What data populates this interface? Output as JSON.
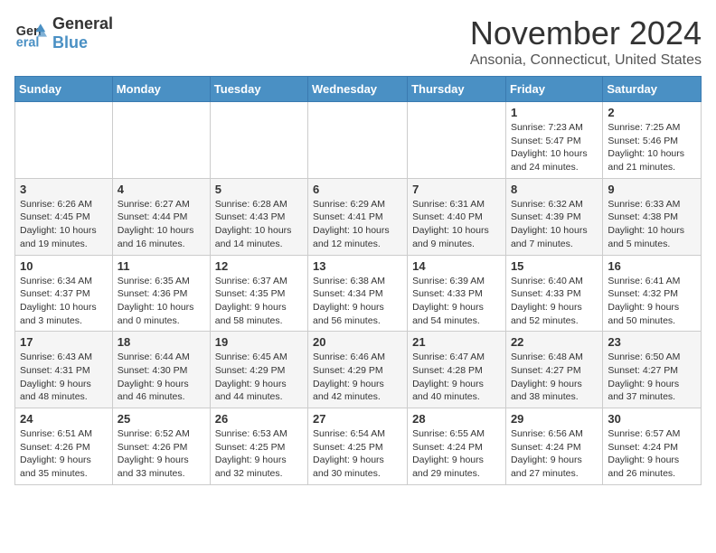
{
  "logo": {
    "line1": "General",
    "line2": "Blue"
  },
  "title": "November 2024",
  "location": "Ansonia, Connecticut, United States",
  "days_of_week": [
    "Sunday",
    "Monday",
    "Tuesday",
    "Wednesday",
    "Thursday",
    "Friday",
    "Saturday"
  ],
  "weeks": [
    [
      {
        "day": "",
        "info": ""
      },
      {
        "day": "",
        "info": ""
      },
      {
        "day": "",
        "info": ""
      },
      {
        "day": "",
        "info": ""
      },
      {
        "day": "",
        "info": ""
      },
      {
        "day": "1",
        "info": "Sunrise: 7:23 AM\nSunset: 5:47 PM\nDaylight: 10 hours and 24 minutes."
      },
      {
        "day": "2",
        "info": "Sunrise: 7:25 AM\nSunset: 5:46 PM\nDaylight: 10 hours and 21 minutes."
      }
    ],
    [
      {
        "day": "3",
        "info": "Sunrise: 6:26 AM\nSunset: 4:45 PM\nDaylight: 10 hours and 19 minutes."
      },
      {
        "day": "4",
        "info": "Sunrise: 6:27 AM\nSunset: 4:44 PM\nDaylight: 10 hours and 16 minutes."
      },
      {
        "day": "5",
        "info": "Sunrise: 6:28 AM\nSunset: 4:43 PM\nDaylight: 10 hours and 14 minutes."
      },
      {
        "day": "6",
        "info": "Sunrise: 6:29 AM\nSunset: 4:41 PM\nDaylight: 10 hours and 12 minutes."
      },
      {
        "day": "7",
        "info": "Sunrise: 6:31 AM\nSunset: 4:40 PM\nDaylight: 10 hours and 9 minutes."
      },
      {
        "day": "8",
        "info": "Sunrise: 6:32 AM\nSunset: 4:39 PM\nDaylight: 10 hours and 7 minutes."
      },
      {
        "day": "9",
        "info": "Sunrise: 6:33 AM\nSunset: 4:38 PM\nDaylight: 10 hours and 5 minutes."
      }
    ],
    [
      {
        "day": "10",
        "info": "Sunrise: 6:34 AM\nSunset: 4:37 PM\nDaylight: 10 hours and 3 minutes."
      },
      {
        "day": "11",
        "info": "Sunrise: 6:35 AM\nSunset: 4:36 PM\nDaylight: 10 hours and 0 minutes."
      },
      {
        "day": "12",
        "info": "Sunrise: 6:37 AM\nSunset: 4:35 PM\nDaylight: 9 hours and 58 minutes."
      },
      {
        "day": "13",
        "info": "Sunrise: 6:38 AM\nSunset: 4:34 PM\nDaylight: 9 hours and 56 minutes."
      },
      {
        "day": "14",
        "info": "Sunrise: 6:39 AM\nSunset: 4:33 PM\nDaylight: 9 hours and 54 minutes."
      },
      {
        "day": "15",
        "info": "Sunrise: 6:40 AM\nSunset: 4:33 PM\nDaylight: 9 hours and 52 minutes."
      },
      {
        "day": "16",
        "info": "Sunrise: 6:41 AM\nSunset: 4:32 PM\nDaylight: 9 hours and 50 minutes."
      }
    ],
    [
      {
        "day": "17",
        "info": "Sunrise: 6:43 AM\nSunset: 4:31 PM\nDaylight: 9 hours and 48 minutes."
      },
      {
        "day": "18",
        "info": "Sunrise: 6:44 AM\nSunset: 4:30 PM\nDaylight: 9 hours and 46 minutes."
      },
      {
        "day": "19",
        "info": "Sunrise: 6:45 AM\nSunset: 4:29 PM\nDaylight: 9 hours and 44 minutes."
      },
      {
        "day": "20",
        "info": "Sunrise: 6:46 AM\nSunset: 4:29 PM\nDaylight: 9 hours and 42 minutes."
      },
      {
        "day": "21",
        "info": "Sunrise: 6:47 AM\nSunset: 4:28 PM\nDaylight: 9 hours and 40 minutes."
      },
      {
        "day": "22",
        "info": "Sunrise: 6:48 AM\nSunset: 4:27 PM\nDaylight: 9 hours and 38 minutes."
      },
      {
        "day": "23",
        "info": "Sunrise: 6:50 AM\nSunset: 4:27 PM\nDaylight: 9 hours and 37 minutes."
      }
    ],
    [
      {
        "day": "24",
        "info": "Sunrise: 6:51 AM\nSunset: 4:26 PM\nDaylight: 9 hours and 35 minutes."
      },
      {
        "day": "25",
        "info": "Sunrise: 6:52 AM\nSunset: 4:26 PM\nDaylight: 9 hours and 33 minutes."
      },
      {
        "day": "26",
        "info": "Sunrise: 6:53 AM\nSunset: 4:25 PM\nDaylight: 9 hours and 32 minutes."
      },
      {
        "day": "27",
        "info": "Sunrise: 6:54 AM\nSunset: 4:25 PM\nDaylight: 9 hours and 30 minutes."
      },
      {
        "day": "28",
        "info": "Sunrise: 6:55 AM\nSunset: 4:24 PM\nDaylight: 9 hours and 29 minutes."
      },
      {
        "day": "29",
        "info": "Sunrise: 6:56 AM\nSunset: 4:24 PM\nDaylight: 9 hours and 27 minutes."
      },
      {
        "day": "30",
        "info": "Sunrise: 6:57 AM\nSunset: 4:24 PM\nDaylight: 9 hours and 26 minutes."
      }
    ]
  ]
}
